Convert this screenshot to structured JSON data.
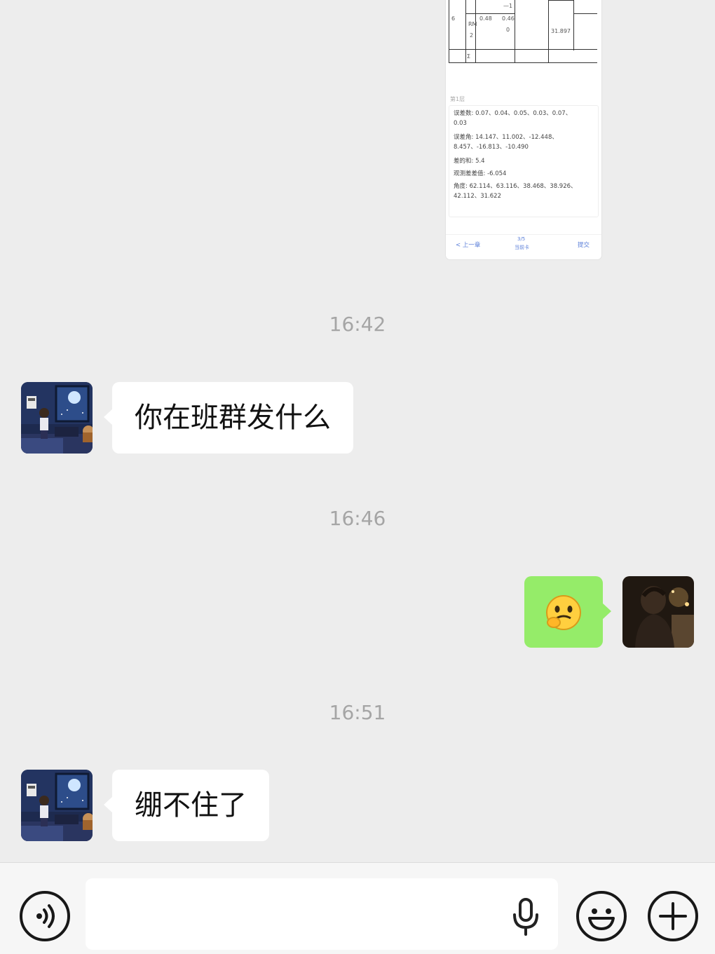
{
  "shared_screenshot": {
    "table_cells": [
      "6",
      "RM",
      "2",
      "0.48",
      "0.46",
      "0",
      "—1",
      "31.897",
      "Σ"
    ],
    "caption": "第1层",
    "calc_lines": [
      "误差数: 0.07、0.04、0.05、0.03、0.07、",
      "0.03",
      "误差角: 14.147、11.002、-12.448、",
      "8.457、-16.813、-10.490",
      "差的和: 5.4",
      "观测差差值: -6.054",
      "角度: 62.114、63.116、38.468、38.926、",
      "42.112、31.622"
    ],
    "footer": {
      "prev": "< 上一章",
      "page_top": "3/5",
      "page_bottom": "当前卡",
      "submit": "提交"
    }
  },
  "messages": [
    {
      "type": "time",
      "text": "16:42"
    },
    {
      "type": "text",
      "side": "left",
      "sender_avatar": "anime-night-room-avatar",
      "text": "你在班群发什么"
    },
    {
      "type": "time",
      "text": "16:46"
    },
    {
      "type": "emoji",
      "side": "right",
      "sender_avatar": "photo-person-avatar",
      "emoji": "🫣"
    },
    {
      "type": "time",
      "text": "16:51"
    },
    {
      "type": "text",
      "side": "left",
      "sender_avatar": "anime-night-room-avatar",
      "text": "绷不住了"
    }
  ],
  "input_bar": {
    "voice_icon": "voice-mode-icon",
    "mic_icon": "microphone-icon",
    "emoji_icon": "emoji-smile-icon",
    "plus_icon": "plus-icon",
    "value": ""
  },
  "colors": {
    "background": "#ededed",
    "bubble_self": "#95ec69",
    "bubble_other": "#ffffff",
    "timestamp": "#a5a5a5"
  }
}
